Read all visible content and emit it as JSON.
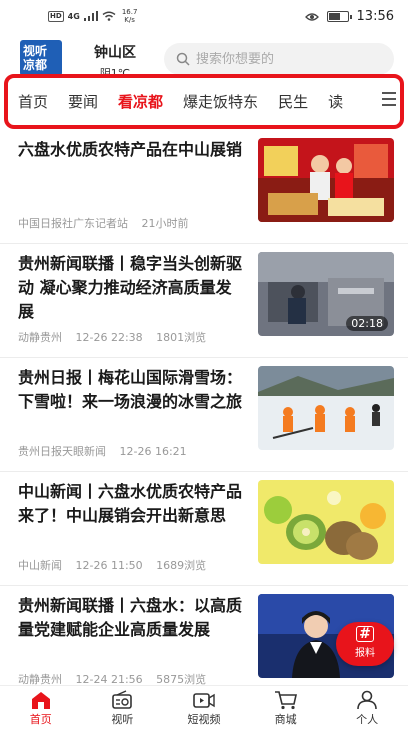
{
  "status_bar": {
    "hd": "HD",
    "signal": "4G",
    "speed_value": "16.7",
    "speed_unit": "K/s",
    "battery_level": 0.7,
    "time": "13:56"
  },
  "header": {
    "logo_line1": "视听",
    "logo_line2": "凉都",
    "city": "钟山区",
    "weather": "阴1℃",
    "search_placeholder": "搜索你想要的"
  },
  "tabs": [
    "首页",
    "要闻",
    "看凉都",
    "爆走饭特东",
    "民生",
    "读"
  ],
  "active_tab_index": 2,
  "colors": {
    "accent": "#e8141b",
    "logo_bg": "#1f5fb6"
  },
  "news": [
    {
      "title": "六盘水优质农特产品在中山展销",
      "meta": [
        "中国日报社广东记者站",
        "21小时前"
      ],
      "duration": ""
    },
    {
      "title": "贵州新闻联播丨稳字当头创新驱动 凝心聚力推动经济高质量发展",
      "meta": [
        "动静贵州",
        "12-26 22:38",
        "1801浏览"
      ],
      "duration": "02:18"
    },
    {
      "title": "贵州日报丨梅花山国际滑雪场：下雪啦！来一场浪漫的冰雪之旅",
      "meta": [
        "贵州日报天眼新闻",
        "12-26 16:21"
      ],
      "duration": ""
    },
    {
      "title": "中山新闻丨六盘水优质农特产品来了！中山展销会开出新意思",
      "meta": [
        "中山新闻",
        "12-26 11:50",
        "1689浏览"
      ],
      "duration": ""
    },
    {
      "title": "贵州新闻联播丨六盘水：以高质量党建赋能企业高质量发展",
      "meta": [
        "动静贵州",
        "12-24 21:56",
        "5875浏览"
      ],
      "duration": ""
    }
  ],
  "fab": {
    "icon": "#",
    "label": "报料"
  },
  "bottom_nav": [
    {
      "label": "首页",
      "icon": "home-icon"
    },
    {
      "label": "视听",
      "icon": "radio-icon"
    },
    {
      "label": "短视频",
      "icon": "video-icon"
    },
    {
      "label": "商城",
      "icon": "cart-icon"
    },
    {
      "label": "个人",
      "icon": "person-icon"
    }
  ]
}
